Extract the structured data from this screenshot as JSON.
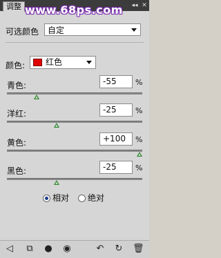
{
  "window": {
    "tab_label": "调整",
    "watermark": "www.68ps.com",
    "menu_icon": "panel-menu-icon"
  },
  "header": {
    "title": "可选颜色",
    "preset_value": "自定"
  },
  "colors": {
    "label": "颜色:",
    "selected": "红色",
    "selected_color": "#e00000"
  },
  "sliders": [
    {
      "label": "青色:",
      "value": "-55",
      "unit": "%",
      "level": -55
    },
    {
      "label": "洋红:",
      "value": "-25",
      "unit": "%",
      "level": -25
    },
    {
      "label": "黄色:",
      "value": "+100",
      "unit": "%",
      "level": 100
    },
    {
      "label": "黑色:",
      "value": "-25",
      "unit": "%",
      "level": -25
    }
  ],
  "method": {
    "relative_label": "相对",
    "absolute_label": "绝对",
    "selected": "relative"
  },
  "footer_icons": [
    "back-arrow-icon",
    "expand-view-icon",
    "clip-layer-icon",
    "visibility-eye-icon",
    "previous-state-icon",
    "reset-icon",
    "trash-icon"
  ]
}
